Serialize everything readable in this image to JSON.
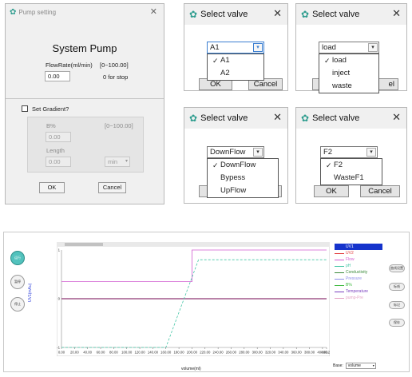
{
  "pump": {
    "title": "Pump setting",
    "heading": "System Pump",
    "flowrate_label": "FlowRate(ml/min)",
    "flowrate_range": "[0~100.00]",
    "flowrate_value": "0.00",
    "flowrate_hint": "0 for stop",
    "gradient_label": "Set Gradient?",
    "b_label": "B%",
    "b_range": "[0~100.00]",
    "b_value": "0.00",
    "length_label": "Length",
    "length_value": "0.00",
    "length_unit": "min",
    "ok": "OK",
    "cancel": "Cancel"
  },
  "valve1": {
    "title": "Select valve",
    "selected": "A1",
    "options": [
      "A1",
      "A2"
    ],
    "checked": 0,
    "ok": "OK",
    "cancel": "Cancel"
  },
  "valve2": {
    "title": "Select valve",
    "selected": "load",
    "options": [
      "load",
      "inject",
      "waste"
    ],
    "checked": 0,
    "cancel_tail": "el"
  },
  "valve3": {
    "title": "Select valve",
    "selected": "DownFlow",
    "options": [
      "DownFlow",
      "Bypess",
      "UpFlow"
    ],
    "checked": 0
  },
  "valve4": {
    "title": "Select valve",
    "selected": "F2",
    "options": [
      "F2",
      "WasteF1"
    ],
    "checked": 0,
    "ok": "OK",
    "cancel": "Cancel"
  },
  "chart": {
    "left_buttons": [
      "运行",
      "暂停",
      "停止"
    ],
    "y_axis_label": "UV1(mAu)",
    "x_axis_label": "volume(ml)",
    "base_label": "Base:",
    "base_value": "volume",
    "right_buttons": [
      "曲线设置",
      "标线",
      "标记",
      "保存"
    ],
    "legend": [
      {
        "name": "UV1",
        "color": "#1533cc",
        "selected": true
      },
      {
        "name": "UV2",
        "color": "#e23b3b"
      },
      {
        "name": "Flow",
        "color": "#d15bd1"
      },
      {
        "name": "pH",
        "color": "#44c6a6"
      },
      {
        "name": "Conductivity",
        "color": "#3a8a3a"
      },
      {
        "name": "Pressure",
        "color": "#8e8ee8"
      },
      {
        "name": "B%",
        "color": "#3cb83c"
      },
      {
        "name": "Temperature",
        "color": "#7a3fbf"
      },
      {
        "name": "pump-Pre",
        "color": "#e4a3c4"
      }
    ]
  },
  "chart_data": {
    "type": "line",
    "x_ticks": [
      "0.00",
      "20.00",
      "40.00",
      "60.00",
      "80.00",
      "100.00",
      "120.00",
      "140.00",
      "160.00",
      "180.00",
      "200.00",
      "220.00",
      "240.00",
      "260.00",
      "280.00",
      "300.00",
      "320.00",
      "340.00",
      "360.00",
      "380.00",
      "400.00",
      "406.24"
    ],
    "y_ticks": [
      "1",
      "0",
      "-1"
    ],
    "xlim": [
      0,
      406.24
    ],
    "ylim": [
      -1,
      1
    ],
    "xlabel": "volume(ml)",
    "ylabel": "UV1(mAu)",
    "series": [
      {
        "name": "UV1",
        "color": "#1533cc",
        "x": [
          0,
          406.24
        ],
        "y": [
          0,
          0
        ]
      },
      {
        "name": "UV2",
        "color": "#e23b3b",
        "x": [
          0,
          406.24
        ],
        "y": [
          0,
          0
        ]
      },
      {
        "name": "Flow",
        "color": "#d15bd1",
        "x": [
          0,
          200,
          200,
          406.24
        ],
        "y": [
          0.35,
          0.35,
          1,
          1
        ]
      },
      {
        "name": "pH",
        "color": "#44c6a6",
        "dash": true,
        "x": [
          0,
          160,
          210,
          215,
          406.24
        ],
        "y": [
          -1,
          -1,
          0.8,
          0.8,
          0.8
        ]
      }
    ]
  }
}
